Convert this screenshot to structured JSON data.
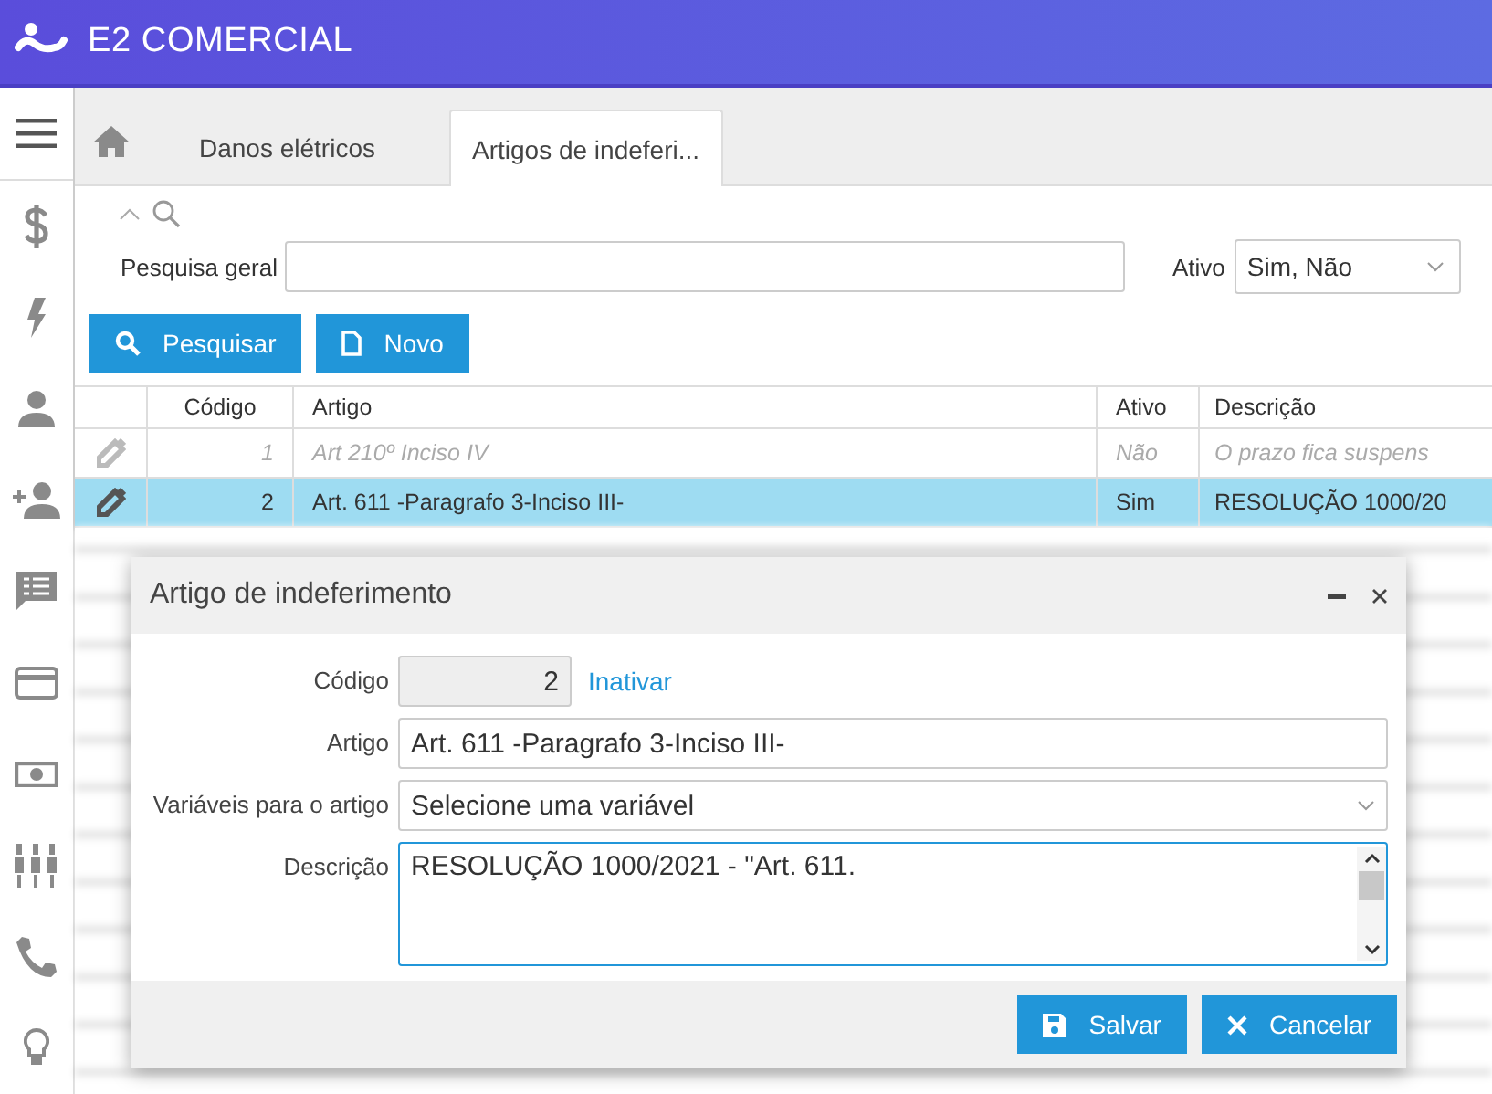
{
  "app": {
    "brand": "E2 COMERCIAL"
  },
  "tabs": [
    {
      "label": "Danos elétricos",
      "selected": false
    },
    {
      "label": "Artigos de indeferi...",
      "selected": true
    }
  ],
  "search": {
    "label": "Pesquisa geral",
    "active_label": "Ativo",
    "active_value": "Sim, Não"
  },
  "buttons": [
    {
      "label": "Pesquisar",
      "kind": "search"
    },
    {
      "label": "Novo",
      "kind": "new"
    }
  ],
  "table": {
    "columns": [
      "Código",
      "Artigo",
      "Ativo",
      "Descrição"
    ],
    "rows": [
      {
        "cells": [
          "1",
          "Art 210º Inciso IV",
          "Não",
          "O prazo fica suspens"
        ],
        "active": false,
        "selected": false
      },
      {
        "cells": [
          "2",
          "Art. 611 -Paragrafo 3-Inciso III-",
          "Sim",
          "RESOLUÇÃO 1000/20"
        ],
        "active": true,
        "selected": true
      }
    ]
  },
  "dialog": {
    "title": "Artigo de indeferimento",
    "fields": [
      {
        "label": "Código",
        "kind": "code",
        "value": "2",
        "disabled": true,
        "link": "Inativar"
      },
      {
        "label": "Artigo",
        "kind": "text",
        "value": "Art. 611 -Paragrafo 3-Inciso III-"
      },
      {
        "label": "Variáveis para o artigo",
        "kind": "select",
        "value": "Selecione uma variável"
      },
      {
        "label": "Descrição",
        "kind": "textarea",
        "value": "RESOLUÇÃO 1000/2021 - \"Art. 611."
      }
    ],
    "buttons": [
      {
        "label": "Salvar",
        "kind": "save"
      },
      {
        "label": "Cancelar",
        "kind": "cancel"
      }
    ]
  }
}
